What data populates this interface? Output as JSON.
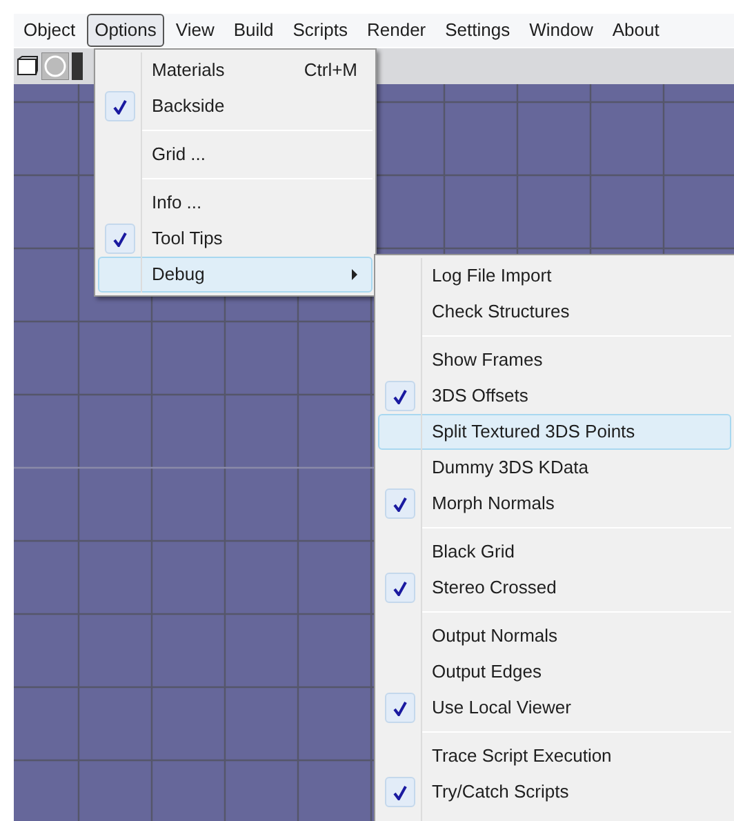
{
  "menu_bar": [
    {
      "label": "Object",
      "selected": false
    },
    {
      "label": "Options",
      "selected": true
    },
    {
      "label": "View",
      "selected": false
    },
    {
      "label": "Build",
      "selected": false
    },
    {
      "label": "Scripts",
      "selected": false
    },
    {
      "label": "Render",
      "selected": false
    },
    {
      "label": "Settings",
      "selected": false
    },
    {
      "label": "Window",
      "selected": false
    },
    {
      "label": "About",
      "selected": false
    }
  ],
  "options_menu": {
    "sections": [
      [
        {
          "label": "Materials",
          "shortcut": "Ctrl+M",
          "checked": false,
          "selected": false,
          "submenu": false
        },
        {
          "label": "Backside",
          "checked": true,
          "selected": false,
          "submenu": false
        }
      ],
      [
        {
          "label": "Grid ...",
          "checked": false,
          "selected": false,
          "submenu": false
        }
      ],
      [
        {
          "label": "Info ...",
          "checked": false,
          "selected": false,
          "submenu": false
        },
        {
          "label": "Tool Tips",
          "checked": true,
          "selected": false,
          "submenu": false
        },
        {
          "label": "Debug",
          "checked": false,
          "selected": true,
          "submenu": true
        }
      ]
    ]
  },
  "debug_menu": {
    "sections": [
      [
        {
          "label": "Log File Import",
          "checked": false,
          "selected": false
        },
        {
          "label": "Check Structures",
          "checked": false,
          "selected": false
        }
      ],
      [
        {
          "label": "Show Frames",
          "checked": false,
          "selected": false
        },
        {
          "label": "3DS Offsets",
          "checked": true,
          "selected": false
        },
        {
          "label": "Split Textured 3DS Points",
          "checked": false,
          "selected": true
        },
        {
          "label": "Dummy 3DS KData",
          "checked": false,
          "selected": false
        },
        {
          "label": "Morph Normals",
          "checked": true,
          "selected": false
        }
      ],
      [
        {
          "label": "Black Grid",
          "checked": false,
          "selected": false
        },
        {
          "label": "Stereo Crossed",
          "checked": true,
          "selected": false
        }
      ],
      [
        {
          "label": "Output Normals",
          "checked": false,
          "selected": false
        },
        {
          "label": "Output Edges",
          "checked": false,
          "selected": false
        },
        {
          "label": "Use Local Viewer",
          "checked": true,
          "selected": false
        }
      ],
      [
        {
          "label": "Trace Script Execution",
          "checked": false,
          "selected": false
        },
        {
          "label": "Try/Catch Scripts",
          "checked": true,
          "selected": false
        }
      ]
    ]
  }
}
